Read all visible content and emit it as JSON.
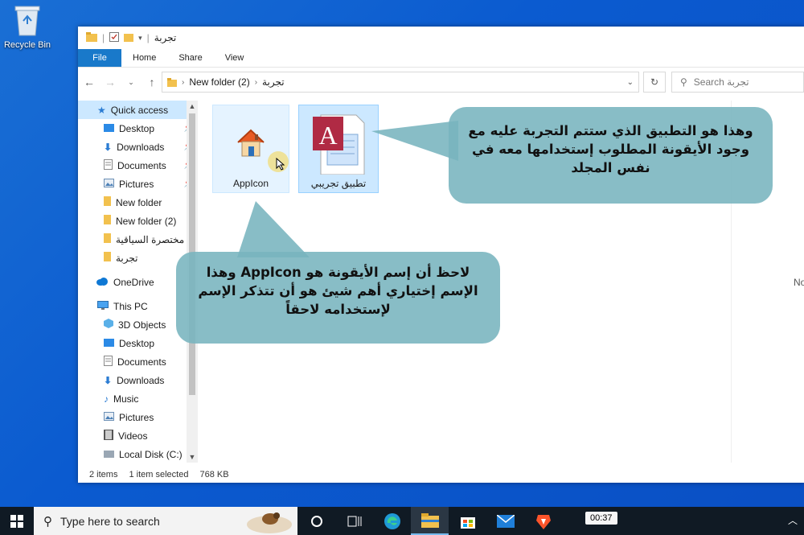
{
  "desktop": {
    "recycle_bin_label": "Recycle Bin"
  },
  "window": {
    "title": "تجربة",
    "ribbon_tabs": [
      "File",
      "Home",
      "Share",
      "View"
    ],
    "address": {
      "segment1": "New folder (2)",
      "segment2": "تجربة"
    },
    "search_placeholder": "Search تجربة",
    "nav": {
      "quick_access": "Quick access",
      "quick_items": [
        "Desktop",
        "Downloads",
        "Documents",
        "Pictures"
      ],
      "folders": [
        "New folder",
        "New folder (2)",
        "مختصرة السياقية",
        "تجربة"
      ],
      "onedrive": "OneDrive",
      "this_pc": "This PC",
      "pc_items": [
        "3D Objects",
        "Desktop",
        "Documents",
        "Downloads",
        "Music",
        "Pictures",
        "Videos",
        "Local Disk (C:)"
      ]
    },
    "files": [
      {
        "name": "AppIcon"
      },
      {
        "name": "تطبيق تجريبي"
      }
    ],
    "right_partial_text": "No",
    "status": {
      "count": "2 items",
      "selection": "1 item selected",
      "size": "768 KB"
    }
  },
  "callouts": {
    "top": "وهذا هو التطبيق الذي ستتم التجربة عليه مع وجود الأيقونة المطلوب إستخدامها معه في نفس المجلد",
    "bottom": "لاحظ أن إسم الأيقونة هو AppIcon وهذا الإسم إختياري أهم شيئ هو أن تتذكر الإسم لإستخدامه لاحقاً"
  },
  "taskbar": {
    "search_placeholder": "Type here to search",
    "clock": "00:37"
  }
}
